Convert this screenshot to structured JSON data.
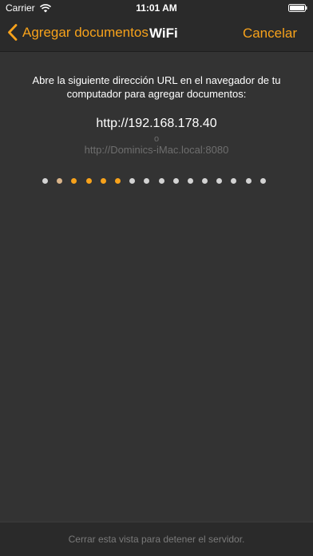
{
  "status_bar": {
    "carrier": "Carrier",
    "time": "11:01 AM"
  },
  "nav": {
    "back_label": "Agregar documentos",
    "title": "WiFi",
    "cancel_label": "Cancelar"
  },
  "main": {
    "instructions": "Abre la siguiente dirección URL en el navegador de tu computador para agregar documentos:",
    "url_primary": "http://192.168.178.40",
    "or_text": "o",
    "url_secondary": "http://Dominics-iMac.local:8080"
  },
  "progress_dots": {
    "count": 16,
    "active": [
      2,
      3,
      4,
      5
    ],
    "fading": [
      1
    ]
  },
  "footer": {
    "text": "Cerrar esta vista para detener el servidor."
  },
  "colors": {
    "accent": "#f7a21b",
    "background": "#333333",
    "bar": "#2a2a2a"
  },
  "icons": {
    "back": "chevron-left-icon",
    "wifi": "wifi-icon",
    "battery": "battery-icon"
  }
}
